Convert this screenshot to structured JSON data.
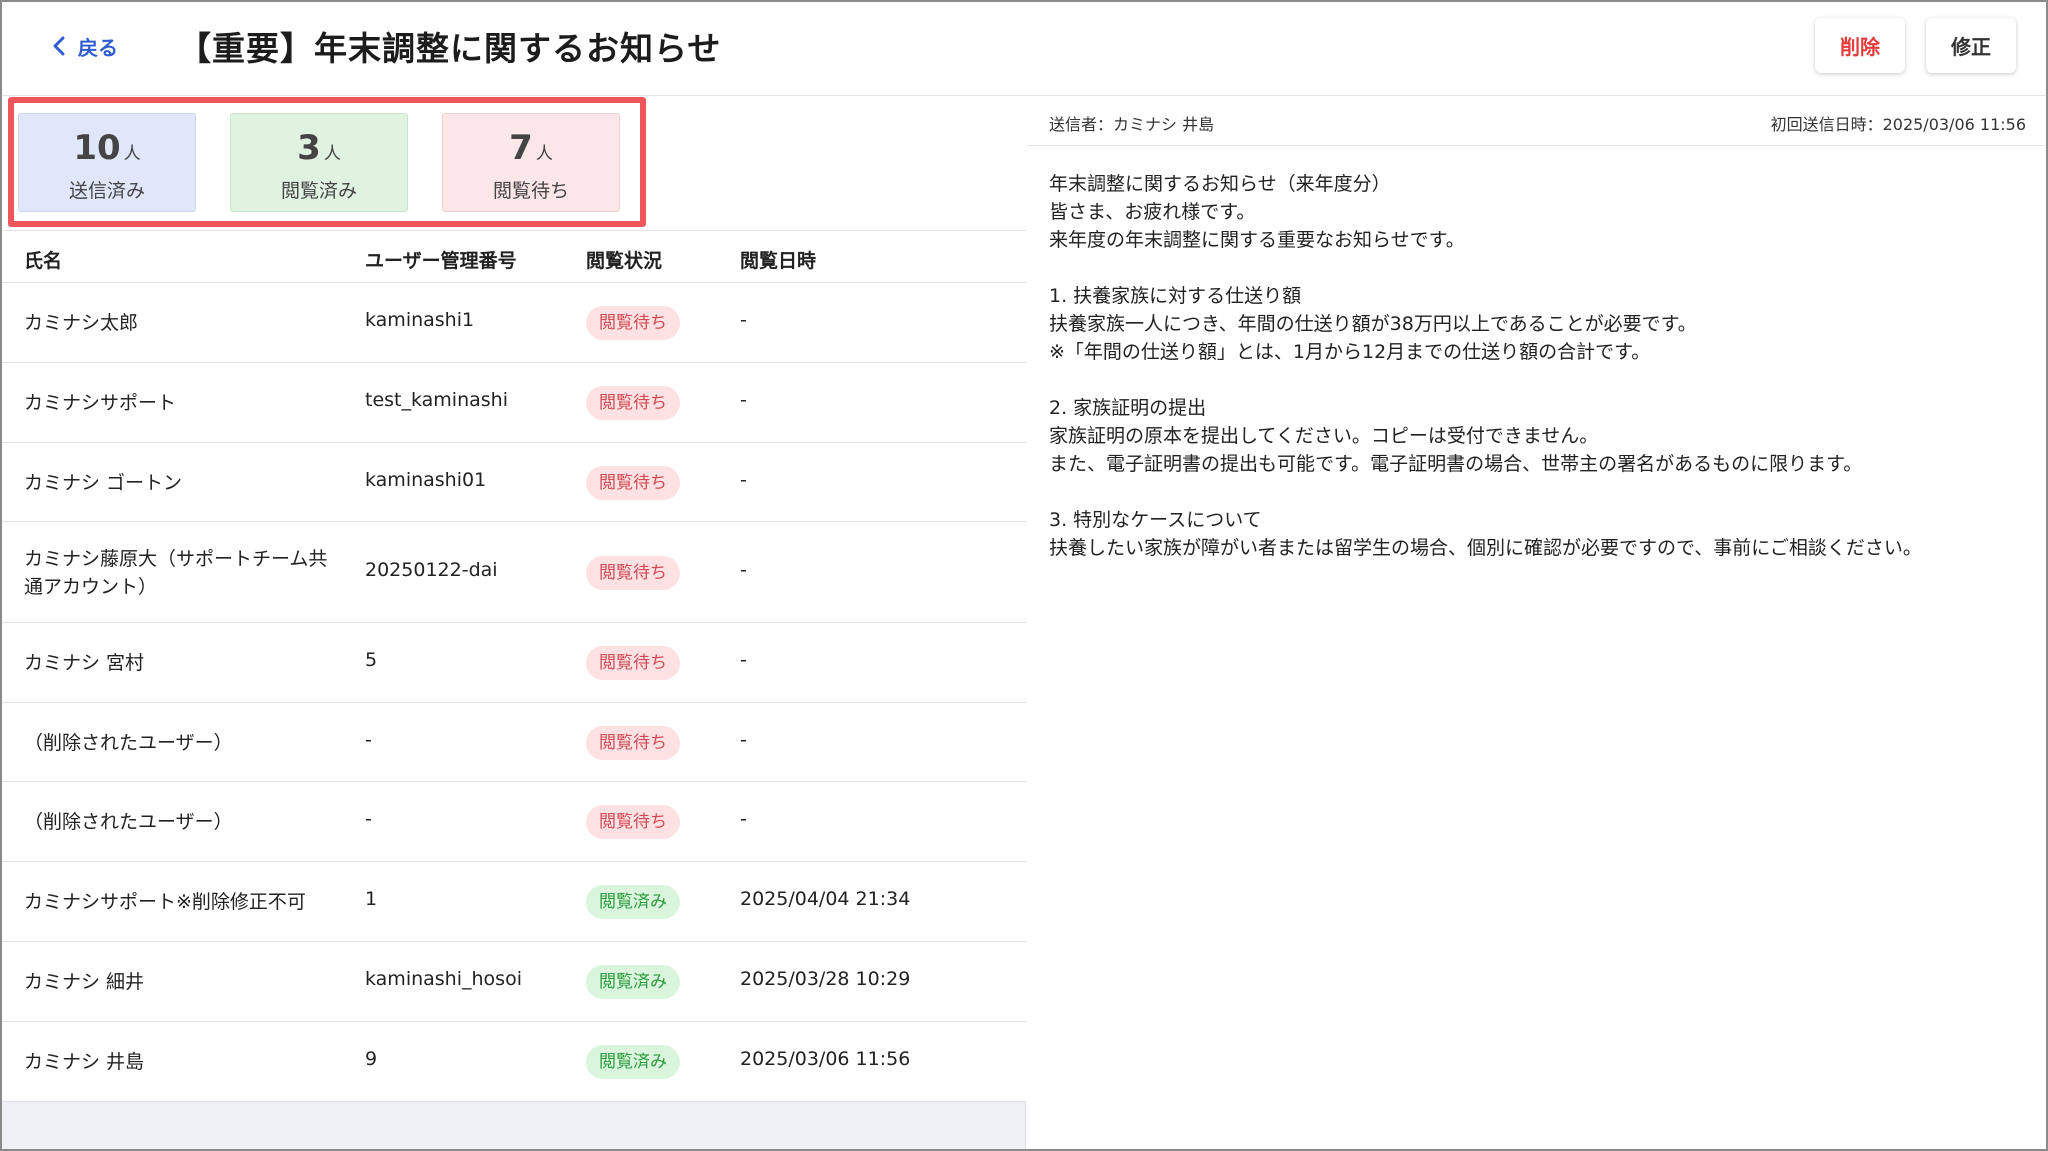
{
  "header": {
    "back_label": "戻る",
    "title": "【重要】年末調整に関するお知らせ",
    "delete_label": "削除",
    "edit_label": "修正"
  },
  "stats": {
    "sent": {
      "count": "10",
      "unit": "人",
      "label": "送信済み"
    },
    "read": {
      "count": "3",
      "unit": "人",
      "label": "閲覧済み"
    },
    "waiting": {
      "count": "7",
      "unit": "人",
      "label": "閲覧待ち"
    }
  },
  "table": {
    "headers": {
      "name": "氏名",
      "id": "ユーザー管理番号",
      "status": "閲覧状況",
      "date": "閲覧日時"
    },
    "rows": [
      {
        "name": "カミナシ太郎",
        "id": "kaminashi1",
        "status": "閲覧待ち",
        "date": "-"
      },
      {
        "name": "カミナシサポート",
        "id": "test_kaminashi",
        "status": "閲覧待ち",
        "date": "-"
      },
      {
        "name": "カミナシ ゴートン",
        "id": "kaminashi01",
        "status": "閲覧待ち",
        "date": "-"
      },
      {
        "name": "カミナシ藤原大（サポートチーム共通アカウント）",
        "id": "20250122-dai",
        "status": "閲覧待ち",
        "date": "-"
      },
      {
        "name": "カミナシ 宮村",
        "id": "5",
        "status": "閲覧待ち",
        "date": "-"
      },
      {
        "name": "（削除されたユーザー）",
        "id": "-",
        "status": "閲覧待ち",
        "date": "-"
      },
      {
        "name": "（削除されたユーザー）",
        "id": "-",
        "status": "閲覧待ち",
        "date": "-"
      },
      {
        "name": "カミナシサポート※削除修正不可",
        "id": "1",
        "status": "閲覧済み",
        "date": "2025/04/04 21:34"
      },
      {
        "name": "カミナシ 細井",
        "id": "kaminashi_hosoi",
        "status": "閲覧済み",
        "date": "2025/03/28 10:29"
      },
      {
        "name": "カミナシ 井島",
        "id": "9",
        "status": "閲覧済み",
        "date": "2025/03/06 11:56"
      }
    ]
  },
  "message": {
    "sender": "送信者：カミナシ 井島",
    "first_sent_at": "初回送信日時：2025/03/06 11:56",
    "lines": [
      "年末調整に関するお知らせ（来年度分）",
      "皆さま、お疲れ様です。",
      "来年度の年末調整に関する重要なお知らせです。",
      "",
      "1. 扶養家族に対する仕送り額",
      "扶養家族一人につき、年間の仕送り額が38万円以上であることが必要です。",
      "※「年間の仕送り額」とは、1月から12月までの仕送り額の合計です。",
      "",
      "2. 家族証明の提出",
      "家族証明の原本を提出してください。コピーは受付できません。",
      "また、電子証明書の提出も可能です。電子証明書の場合、世帯主の署名があるものに限ります。",
      "",
      "3. 特別なケースについて",
      "扶養したい家族が障がい者または留学生の場合、個別に確認が必要ですので、事前にご相談ください。"
    ]
  },
  "colors": {
    "accent": "#2f5bd3",
    "danger": "#e53b3b",
    "badge_wait_bg": "#fde1e3",
    "badge_read_bg": "#d9f6dc",
    "highlight_outline": "#f0555c"
  }
}
